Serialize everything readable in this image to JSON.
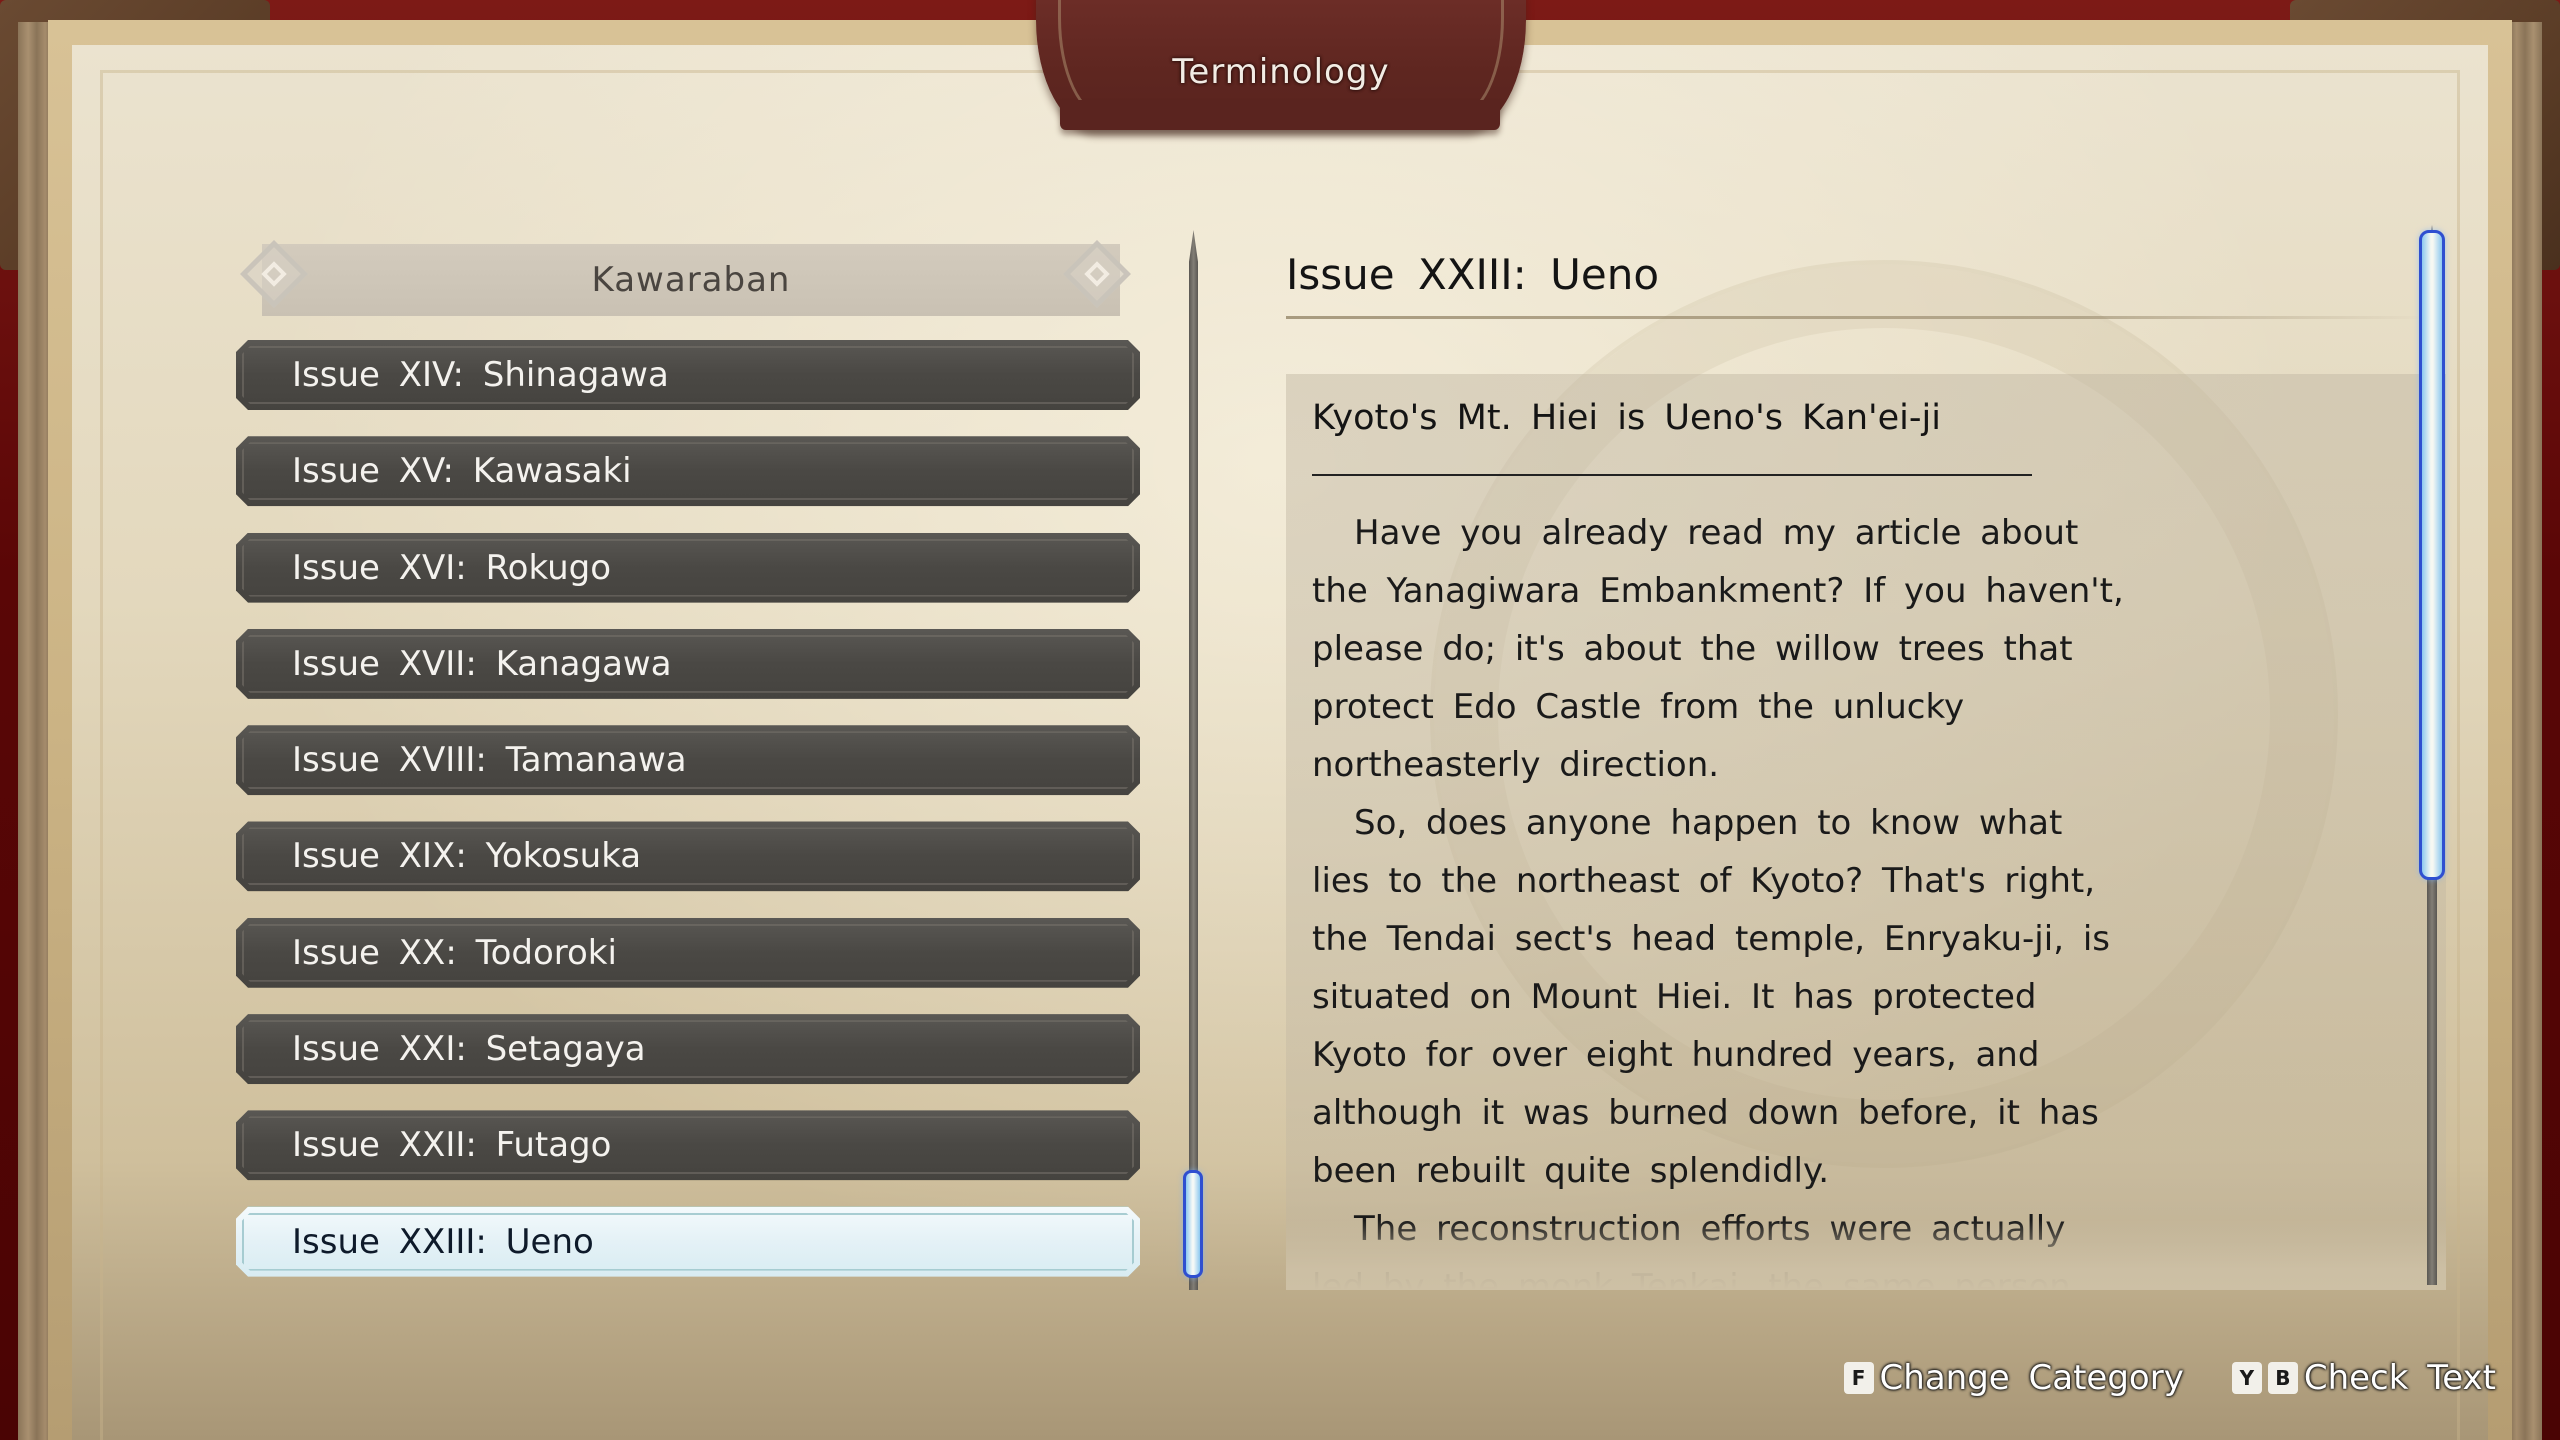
{
  "screen": {
    "title": "Terminology"
  },
  "list": {
    "category": "Kawaraban",
    "items": [
      {
        "label": "Issue XIV: Shinagawa",
        "selected": false
      },
      {
        "label": "Issue XV: Kawasaki",
        "selected": false
      },
      {
        "label": "Issue XVI: Rokugo",
        "selected": false
      },
      {
        "label": "Issue XVII: Kanagawa",
        "selected": false
      },
      {
        "label": "Issue XVIII: Tamanawa",
        "selected": false
      },
      {
        "label": "Issue XIX: Yokosuka",
        "selected": false
      },
      {
        "label": "Issue XX: Todoroki",
        "selected": false
      },
      {
        "label": "Issue XXI: Setagaya",
        "selected": false
      },
      {
        "label": "Issue XXII: Futago",
        "selected": false
      },
      {
        "label": "Issue XXIII: Ueno",
        "selected": true
      }
    ],
    "scroll_position_fraction": 1.0
  },
  "detail": {
    "title": "Issue XXIII: Ueno",
    "subject": "Kyoto's Mt. Hiei is Ueno's Kan'ei-ji",
    "paragraphs": [
      "Have you already read my article about the Yanagiwara Embankment? If you haven't, please do; it's about the willow trees that protect Edo Castle from the unlucky northeasterly direction.",
      "So, does anyone happen to know what lies to the northeast of Kyoto? That's right, the Tendai sect's head temple, Enryaku-ji, is situated on Mount Hiei. It has protected Kyoto for over eight hundred years, and although it was burned down before, it has been rebuilt quite splendidly.",
      "The reconstruction efforts were actually led by the monk Tenkai, the same person who"
    ],
    "scroll_position_fraction": 0.0,
    "scroll_visible_fraction": 0.6
  },
  "footer": {
    "hints": [
      {
        "keys": [
          "F"
        ],
        "label": "Change Category"
      },
      {
        "keys": [
          "Y",
          "B"
        ],
        "label": "Check Text"
      }
    ]
  },
  "colors": {
    "selected_glow": "#2f4fd0",
    "list_item_bg": "#4a4844",
    "title_tab_bg": "#5e2620"
  }
}
